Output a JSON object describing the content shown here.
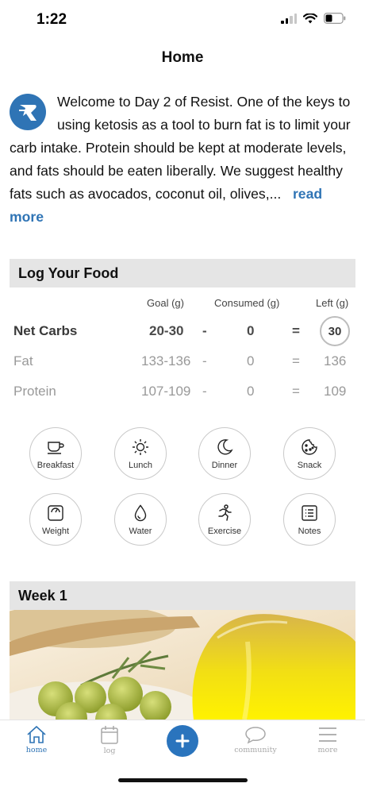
{
  "status_bar": {
    "time": "1:22"
  },
  "header": {
    "title": "Home"
  },
  "welcome": {
    "text": "Welcome to Day 2 of Resist. One of the keys to using ketosis as a tool to burn fat is to limit your carb intake. Protein should be kept at moderate levels, and fats should be eaten liberally. We suggest healthy fats such as avocados, coconut oil, olives,...",
    "read_more": "read more"
  },
  "log": {
    "title": "Log Your Food",
    "headers": {
      "goal": "Goal (g)",
      "consumed": "Consumed (g)",
      "left": "Left (g)"
    },
    "rows": [
      {
        "name": "Net Carbs",
        "goal": "20-30",
        "minus": "-",
        "consumed": "0",
        "equals": "=",
        "left": "30"
      },
      {
        "name": "Fat",
        "goal": "133-136",
        "minus": "-",
        "consumed": "0",
        "equals": "=",
        "left": "136"
      },
      {
        "name": "Protein",
        "goal": "107-109",
        "minus": "-",
        "consumed": "0",
        "equals": "=",
        "left": "109"
      }
    ]
  },
  "actions": [
    {
      "label": "Breakfast",
      "icon": "coffee-cup-icon"
    },
    {
      "label": "Lunch",
      "icon": "sun-icon"
    },
    {
      "label": "Dinner",
      "icon": "moon-icon"
    },
    {
      "label": "Snack",
      "icon": "cookie-icon"
    },
    {
      "label": "Weight",
      "icon": "scale-icon"
    },
    {
      "label": "Water",
      "icon": "water-drop-icon"
    },
    {
      "label": "Exercise",
      "icon": "running-icon"
    },
    {
      "label": "Notes",
      "icon": "notes-list-icon"
    }
  ],
  "week": {
    "title": "Week 1"
  },
  "tab_bar": {
    "tabs": [
      {
        "label": "home",
        "icon": "home-icon",
        "active": true
      },
      {
        "label": "log",
        "icon": "calendar-icon",
        "active": false
      },
      {
        "label": "",
        "icon": "plus-icon",
        "active": false
      },
      {
        "label": "community",
        "icon": "chat-bubble-icon",
        "active": false
      },
      {
        "label": "more",
        "icon": "menu-icon",
        "active": false
      }
    ]
  },
  "colors": {
    "accent": "#2f74b5",
    "section_bg": "#e5e5e5",
    "muted_text": "#999999"
  }
}
